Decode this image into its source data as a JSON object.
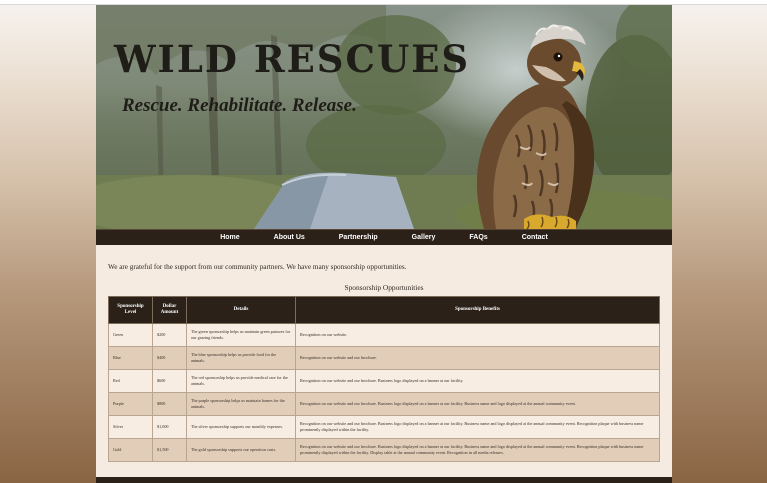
{
  "header": {
    "title": "WILD RESCUES",
    "tagline": "Rescue. Rehabilitate. Release."
  },
  "nav": {
    "items": [
      "Home",
      "About Us",
      "Partnership",
      "Gallery",
      "FAQs",
      "Contact"
    ]
  },
  "content": {
    "intro": "We are grateful for the support from our community partners. We have many sponsorship opportunities.",
    "table_title": "Sponsorship Opportunities",
    "columns": [
      "Sponsorship Level",
      "Dollar Amount",
      "Details",
      "Sponsorship Benefits"
    ],
    "rows": [
      {
        "level": "Green",
        "amount": "$200",
        "details": "The green sponsorship helps us maintain green pastures for our grazing friends.",
        "benefits": "Recognition on our website."
      },
      {
        "level": "Blue",
        "amount": "$400",
        "details": "The blue sponsorship helps us provide food for the animals.",
        "benefits": "Recognition on our website and our brochure."
      },
      {
        "level": "Red",
        "amount": "$600",
        "details": "The red sponsorship helps us provide medical care for the animals.",
        "benefits": "Recognition on our website and our brochure. Business logo displayed on a banner at our facility."
      },
      {
        "level": "Purple",
        "amount": "$800",
        "details": "The purple sponsorship helps us maintain homes for the animals.",
        "benefits": "Recognition on our website and our brochure. Business logo displayed on a banner at our facility. Business name and logo displayed at the annual community event."
      },
      {
        "level": "Silver",
        "amount": "$1,000",
        "details": "The silver sponsorship supports our monthly expenses.",
        "benefits": "Recognition on our website and our brochure. Business logo displayed on a banner at our facility. Business name and logo displayed at the annual community event. Recognition plaque with business name prominently displayed within the facility."
      },
      {
        "level": "Gold",
        "amount": "$1,500",
        "details": "The gold sponsorship supports our operation costs.",
        "benefits": "Recognition on our website and our brochure. Business logo displayed on a banner at our facility. Business name and logo displayed at the annual community event. Recognition plaque with business name prominently displayed within the facility. Display table at the annual community event. Recognition in all media releases."
      }
    ]
  },
  "colors": {
    "nav_background": "#2c2119",
    "table_header": "#2b2119",
    "row_light": "#f8ede3",
    "row_dark": "#e2cdb9"
  },
  "images": {
    "hero": "hawk-photo"
  }
}
